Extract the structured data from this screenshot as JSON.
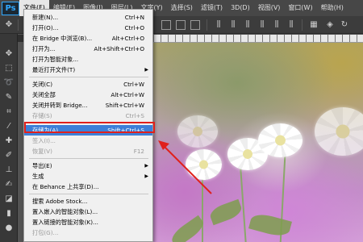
{
  "app": {
    "logo": "Ps"
  },
  "menubar": {
    "items": [
      "文件(F)",
      "编辑(E)",
      "图像(I)",
      "图层(L)",
      "文字(Y)",
      "选择(S)",
      "滤镜(T)",
      "3D(D)",
      "视图(V)",
      "窗口(W)",
      "帮助(H)"
    ],
    "active_index": 0
  },
  "file_menu": {
    "items": [
      {
        "label": "新建(N)...",
        "shortcut": "Ctrl+N",
        "state": "normal"
      },
      {
        "label": "打开(O)...",
        "shortcut": "Ctrl+O",
        "state": "normal"
      },
      {
        "label": "在 Bridge 中浏览(B)...",
        "shortcut": "Alt+Ctrl+O",
        "state": "normal"
      },
      {
        "label": "打开为...",
        "shortcut": "Alt+Shift+Ctrl+O",
        "state": "normal"
      },
      {
        "label": "打开为智能对象...",
        "shortcut": "",
        "state": "normal"
      },
      {
        "label": "最近打开文件(T)",
        "shortcut": "",
        "state": "submenu"
      },
      {
        "label": "关闭(C)",
        "shortcut": "Ctrl+W",
        "state": "normal"
      },
      {
        "label": "关闭全部",
        "shortcut": "Alt+Ctrl+W",
        "state": "normal"
      },
      {
        "label": "关闭并转到 Bridge...",
        "shortcut": "Shift+Ctrl+W",
        "state": "normal"
      },
      {
        "label": "存储(S)",
        "shortcut": "Ctrl+S",
        "state": "disabled"
      },
      {
        "label": "存储为(A)...",
        "shortcut": "Shift+Ctrl+S",
        "state": "highlighted"
      },
      {
        "label": "签入(I)...",
        "shortcut": "",
        "state": "disabled"
      },
      {
        "label": "恢复(V)",
        "shortcut": "F12",
        "state": "disabled"
      },
      {
        "label": "导出(E)",
        "shortcut": "",
        "state": "submenu"
      },
      {
        "label": "生成",
        "shortcut": "",
        "state": "submenu"
      },
      {
        "label": "在 Behance 上共享(D)...",
        "shortcut": "",
        "state": "normal"
      },
      {
        "label": "搜索 Adobe Stock...",
        "shortcut": "",
        "state": "normal"
      },
      {
        "label": "置入嵌入的智能对象(L)...",
        "shortcut": "",
        "state": "normal"
      },
      {
        "label": "置入链接的智能对象(K)...",
        "shortcut": "",
        "state": "normal"
      },
      {
        "label": "打包(G)...",
        "shortcut": "",
        "state": "disabled"
      }
    ]
  },
  "colors": {
    "highlight": "#3c7fd8",
    "annotation": "#e0201b",
    "menubar": "#474747"
  }
}
